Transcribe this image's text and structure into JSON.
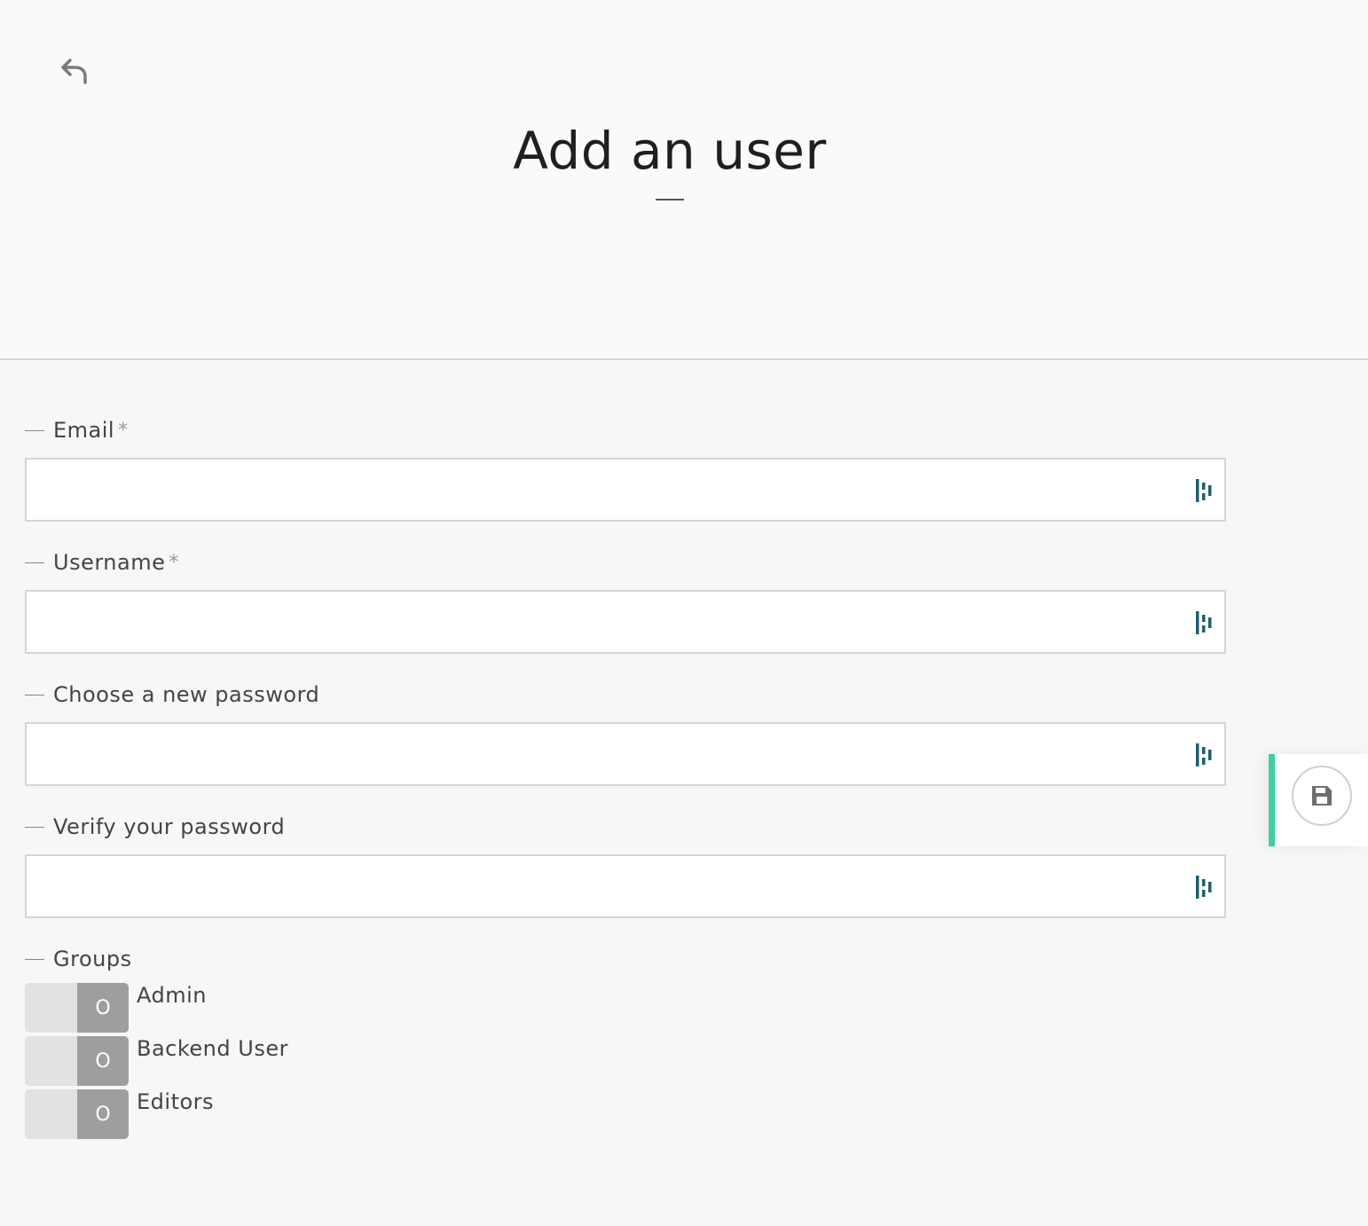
{
  "header": {
    "back_icon": "undo-arrow-icon",
    "title": "Add an user"
  },
  "form": {
    "fields": [
      {
        "label": "Email",
        "required": "*",
        "value": "",
        "placeholder": ""
      },
      {
        "label": "Username",
        "required": "*",
        "value": "",
        "placeholder": ""
      },
      {
        "label": "Choose a new password",
        "value": "",
        "placeholder": ""
      },
      {
        "label": "Verify your password",
        "value": "",
        "placeholder": ""
      }
    ],
    "groups": {
      "label": "Groups",
      "items": [
        {
          "name": "Admin",
          "toggle_text": "O"
        },
        {
          "name": "Backend User",
          "toggle_text": "O"
        },
        {
          "name": "Editors",
          "toggle_text": "O"
        }
      ]
    }
  },
  "save": {
    "icon": "floppy-disk-icon"
  },
  "colors": {
    "accent": "#3ecf9a",
    "password_manager_icon": "#1d5f6b",
    "toggle_knob": "#9e9e9e",
    "toggle_track": "#e2e2e2"
  }
}
